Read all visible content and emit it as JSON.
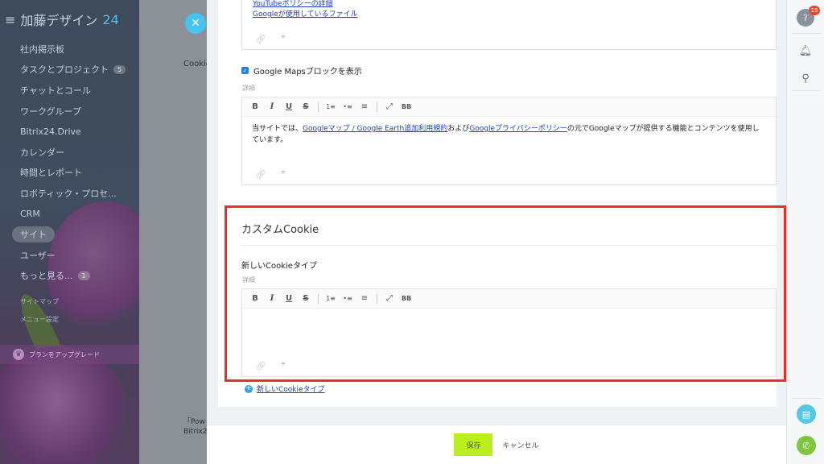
{
  "sidebar": {
    "brand": "加藤デザイン",
    "brand_num": "24",
    "items": [
      {
        "label": "社内掲示板",
        "count": ""
      },
      {
        "label": "タスクとプロジェクト",
        "count": "5"
      },
      {
        "label": "チャットとコール",
        "count": ""
      },
      {
        "label": "ワークグループ",
        "count": ""
      },
      {
        "label": "Bitrix24.Drive",
        "count": ""
      },
      {
        "label": "カレンダー",
        "count": ""
      },
      {
        "label": "時間とレポート",
        "count": ""
      },
      {
        "label": "ロボティック・プロセ...",
        "count": ""
      },
      {
        "label": "CRM",
        "count": ""
      },
      {
        "label": "サイト",
        "count": ""
      },
      {
        "label": "ユーザー",
        "count": ""
      },
      {
        "label": "もっと見る... ",
        "count": "1"
      }
    ],
    "sitemap": "サイトマップ",
    "menu_settings": "メニュー設定",
    "upgrade": "プランをアップグレード"
  },
  "background_page": {
    "cookie_text": "Cookie",
    "pow_text": "「Pow",
    "bitrix_text": "Bitrix2"
  },
  "panel": {
    "top_links": [
      "YouTubeポリシーの詳細",
      "Googleが使用しているファイル"
    ],
    "maps_checkbox_label": "Google Mapsブロックを表示",
    "detail_label": "詳細",
    "toolbar": [
      "B",
      "I",
      "U",
      "S",
      "1≡",
      "•≡",
      "≡",
      "⤢",
      "BB"
    ],
    "maps_text_before": "当サイトでは、",
    "maps_link1": "Googleマップ / Google Earth追加利用規約",
    "maps_text_mid": "および",
    "maps_link2": "Googleプライバシーポリシー",
    "maps_text_after": "の元でGoogleマップが提供する機能とコンテンツを使用しています。",
    "custom_title": "カスタムCookie",
    "new_cookie_type": "新しいCookieタイプ",
    "custom_detail_label": "詳細",
    "add_link": "新しいCookieタイプ",
    "save_label": "保存",
    "cancel_label": "キャンセル"
  },
  "rail": {
    "help_badge": "19"
  },
  "colors": {
    "save_button": "#bbed21",
    "highlight": "#e8302a",
    "link": "#1d3fbf",
    "close_button": "#44c4ee"
  }
}
